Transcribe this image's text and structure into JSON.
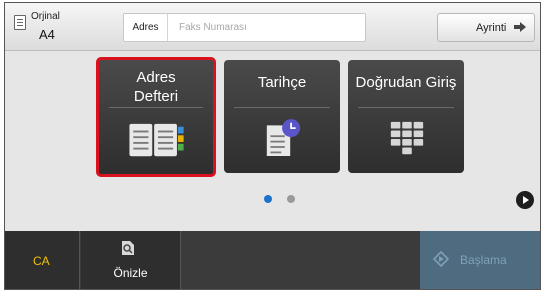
{
  "header": {
    "original_label": "Orjinal",
    "original_size": "A4",
    "address_label": "Adres",
    "address_placeholder": "Faks Numarası",
    "detail_label": "Ayrinti"
  },
  "tiles": [
    {
      "label": "Adres Defteri",
      "icon": "address-book-icon",
      "selected": true
    },
    {
      "label": "Tarihçe",
      "icon": "history-icon",
      "selected": false
    },
    {
      "label": "Doğrudan Giriş",
      "icon": "keypad-icon",
      "selected": false
    }
  ],
  "pager": {
    "current": 1,
    "total": 2
  },
  "bottom": {
    "ca_label": "CA",
    "preview_label": "Önizle",
    "start_label": "Başlama"
  },
  "colors": {
    "selection": "#d8121f",
    "pager_active": "#1e73c8",
    "ca_text": "#f2c200",
    "start_bg": "#4f6b80"
  }
}
